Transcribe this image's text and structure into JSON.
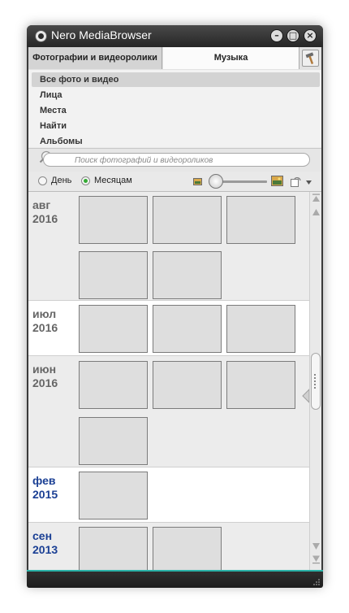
{
  "window": {
    "title": "Nero MediaBrowser"
  },
  "titlebar_buttons": {
    "minimize": "–",
    "maximize": "□",
    "close": "×"
  },
  "tabs": [
    {
      "label": "Фотографии и видеоролики",
      "active": true
    },
    {
      "label": "Музыка",
      "active": false
    }
  ],
  "nav": {
    "items": [
      {
        "label": "Все фото и видео",
        "selected": true
      },
      {
        "label": "Лица",
        "selected": false
      },
      {
        "label": "Места",
        "selected": false
      },
      {
        "label": "Найти",
        "selected": false
      },
      {
        "label": "Альбомы",
        "selected": false
      }
    ]
  },
  "search": {
    "placeholder": "Поиск фотографий и видеороликов"
  },
  "view": {
    "day_label": "День",
    "month_label": "Месяцам",
    "selected": "Месяцам"
  },
  "groups": [
    {
      "month": "авг",
      "year": "2016",
      "color": "#666666",
      "thumbs": 5
    },
    {
      "month": "июл",
      "year": "2016",
      "color": "#666666",
      "thumbs": 3
    },
    {
      "month": "июн",
      "year": "2016",
      "color": "#666666",
      "thumbs": 4
    },
    {
      "month": "фев",
      "year": "2015",
      "color": "#1a3f94",
      "thumbs": 1
    },
    {
      "month": "сен",
      "year": "2013",
      "color": "#1a3f94",
      "thumbs": 2
    }
  ],
  "colors": {
    "accent": "#2ab2a8",
    "titlebar": "#2c2c2c",
    "date_blue": "#1a3f94"
  },
  "icons": [
    "app-icon",
    "minimize-icon",
    "maximize-icon",
    "close-icon",
    "tool-hammer-icon",
    "search-icon",
    "small-thumbnail-icon",
    "large-thumbnail-icon",
    "rotate-view-icon",
    "dropdown-arrow-icon",
    "scroll-top-icon",
    "scroll-up-icon",
    "scroll-down-icon",
    "scroll-bottom-icon",
    "resize-grip-icon"
  ]
}
